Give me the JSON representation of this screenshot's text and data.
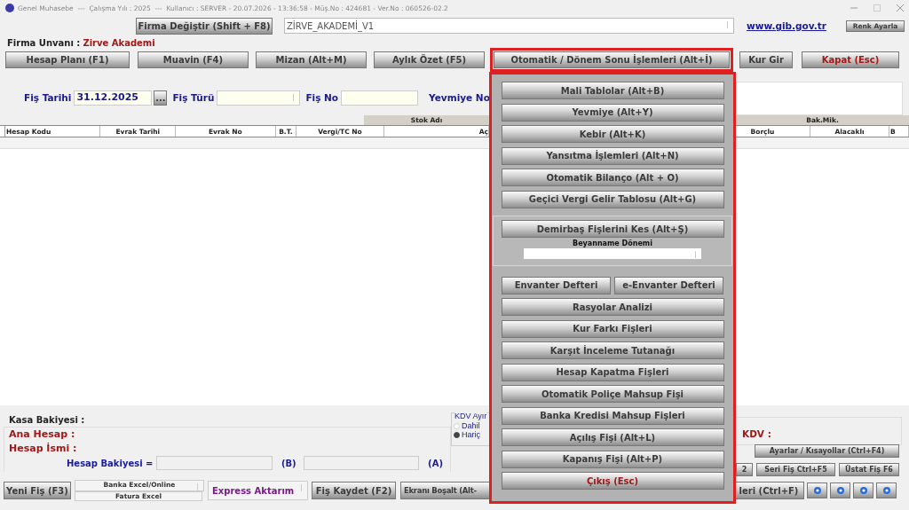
{
  "window": {
    "title": "Genel Muhasebe  ---  Çalışma Yılı : 2025  ---  Kullanıcı : SERVER - 20.07.2026 - 13:36:58 - Müş.No : 424681 - Ver.No : 060526-02.2"
  },
  "header": {
    "change_company_button": "Firma Değiştir (Shift + F8)",
    "company_combo": "ZİRVE_AKADEMİ_V1",
    "link": "www.gib.gov.tr",
    "color_button": "Renk Ayarla",
    "company_label": "Firma Unvanı :",
    "company_name": "Zirve Akademi"
  },
  "toolbar": [
    {
      "label": "Hesap Planı (F1)",
      "kind": "normal",
      "highlighted": false
    },
    {
      "label": "Muavin (F4)",
      "kind": "normal",
      "highlighted": false
    },
    {
      "label": "Mizan (Alt+M)",
      "kind": "normal",
      "highlighted": false
    },
    {
      "label": "Aylık Özet (F5)",
      "kind": "normal",
      "highlighted": false
    },
    {
      "label": "Otomatik / Dönem Sonu İşlemleri (Alt+İ)",
      "kind": "normal",
      "highlighted": true
    },
    {
      "label": "Kur Gir",
      "kind": "normal",
      "highlighted": false
    },
    {
      "label": "Kapat (Esc)",
      "kind": "danger",
      "highlighted": false
    }
  ],
  "voucher_form": {
    "date_label": "Fiş Tarihi",
    "date": "31.12.2025",
    "date_button": "...",
    "type_label": "Fiş Türü",
    "no_label": "Fiş No",
    "journal_label": "Yevmiye No"
  },
  "table": {
    "group_left": "Stok Adı",
    "group_right": "Bak.Mik.",
    "columns_left": [
      "Hesap Kodu",
      "Evrak Tarihi",
      "Evrak No",
      "B.T.",
      "Vergi/TC No",
      "Aç"
    ],
    "columns_right": [
      "Borçlu",
      "Alacaklı",
      "B"
    ]
  },
  "popup": {
    "highlighted": true,
    "items": [
      {
        "kind": "button",
        "label": "Mali Tablolar (Alt+B)"
      },
      {
        "kind": "button",
        "label": "Yevmiye (Alt+Y)"
      },
      {
        "kind": "button",
        "label": "Kebir (Alt+K)"
      },
      {
        "kind": "button",
        "label": "Yansıtma İşlemleri (Alt+N)"
      },
      {
        "kind": "button",
        "label": "Otomatik Bilanço (Alt + O)"
      },
      {
        "kind": "button",
        "label": "Geçici Vergi Gelir Tablosu (Alt+G)"
      },
      {
        "kind": "section",
        "label": "Demirbaş Fişlerini Kes (Alt+Ş)",
        "caption": "Beyanname Dönemi"
      },
      {
        "kind": "pair",
        "labels": [
          "Envanter Defteri",
          "e-Envanter Defteri"
        ]
      },
      {
        "kind": "button",
        "label": "Rasyolar Analizi"
      },
      {
        "kind": "button",
        "label": "Kur Farkı Fişleri"
      },
      {
        "kind": "button",
        "label": "Karşıt İnceleme Tutanağı"
      },
      {
        "kind": "button",
        "label": "Hesap Kapatma Fişleri"
      },
      {
        "kind": "button",
        "label": "Otomatik Poliçe Mahsup Fişi"
      },
      {
        "kind": "button",
        "label": "Banka Kredisi Mahsup Fişleri"
      },
      {
        "kind": "button",
        "label": "Açılış Fişi (Alt+L)"
      },
      {
        "kind": "button",
        "label": "Kapanış Fişi (Alt+P)"
      },
      {
        "kind": "exit",
        "label": "Çıkış (Esc)"
      }
    ]
  },
  "bottom": {
    "cash_label": "Kasa Bakiyesi :",
    "main_account_label": "Ana Hesap :",
    "account_name_label": "Hesap İsmi :",
    "balance_label": "Hesap Bakiyesi =",
    "b_label": "(B)",
    "a_label": "(A)",
    "vat_group": {
      "title": "KDV Ayır",
      "options": [
        {
          "label": "Dahil",
          "selected": false
        },
        {
          "label": "Hariç",
          "selected": true
        }
      ]
    },
    "vat_label": "KDV :",
    "settings_button": "Ayarlar / Kısayollar (Ctrl+F4)",
    "small_buttons": [
      "2",
      "Seri Fiş Ctrl+F5",
      "Üstat Fiş F6"
    ],
    "new_button": "Yeni Fiş (F3)",
    "bank_combo": "Banka Excel/Online",
    "invoice_button": "Fatura Excel",
    "express_combo": "Express Aktarım",
    "save_button": "Fiş Kaydet (F2)",
    "clear_button": "Ekranı Boşalt (Alt-",
    "find_button": "leri (Ctrl+F)"
  }
}
